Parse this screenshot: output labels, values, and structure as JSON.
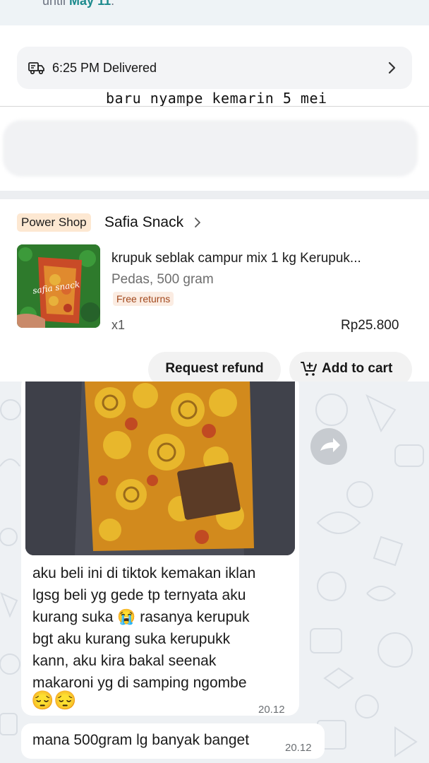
{
  "order": {
    "header_note_prefix": "until",
    "header_note_date": "May 11",
    "header_note_suffix": ".",
    "delivery_status": "6:25 PM Delivered",
    "handwritten_note": "baru nyampe kemarin 5 mei",
    "shop": {
      "badge": "Power Shop",
      "name": "Safia Snack"
    },
    "product": {
      "title": "krupuk seblak campur mix 1 kg Kerupuk...",
      "variant": "Pedas, 500 gram",
      "tag": "Free returns",
      "quantity": "x1",
      "price": "Rp25.800",
      "image_caption": "safia snack"
    },
    "buttons": {
      "refund": "Request refund",
      "add_to_cart": "Add to cart"
    },
    "colors": {
      "badge_bg": "#fde8d2",
      "tag_text": "#a2481d",
      "link_teal": "#1c8a8d"
    }
  },
  "chat": {
    "message_1": {
      "text": "aku beli ini di tiktok kemakan iklan\nlgsg beli yg gede tp ternyata aku\nkurang suka 😭 rasanya kerupuk\nbgt aku kurang suka kerupukk\nkann, aku kira bakal seenak\nmakaroni yg di samping ngombe",
      "emojis": "😔😔",
      "time": "20.12"
    },
    "message_2": {
      "text": "mana 500gram lg banyak banget",
      "time": "20.12"
    },
    "icons": {
      "forward": "forward-icon"
    }
  }
}
